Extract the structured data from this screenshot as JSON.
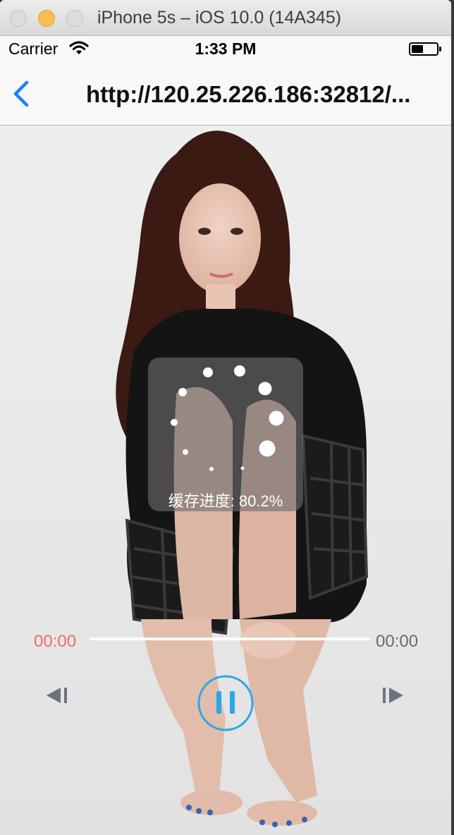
{
  "window": {
    "title": "iPhone 5s – iOS 10.0 (14A345)"
  },
  "status_bar": {
    "carrier": "Carrier",
    "time": "1:33 PM"
  },
  "nav": {
    "title": "http://120.25.226.186:32812/..."
  },
  "player": {
    "buffer_text": "缓存进度: 80.2%",
    "buffer_progress": 0.802,
    "current_time": "00:00",
    "total_time": "00:00",
    "playback_progress": 0,
    "icons": {
      "back": "chevron-left-icon",
      "previous": "skip-previous-icon",
      "pause": "pause-icon",
      "next": "skip-next-icon",
      "wifi": "wifi-icon",
      "battery": "battery-icon"
    }
  },
  "colors": {
    "ios_blue": "#1a82f7",
    "accent_cyan": "#2aa7e8",
    "current_time_red": "#f06b6b",
    "total_time_gray": "#6a6a6a"
  }
}
